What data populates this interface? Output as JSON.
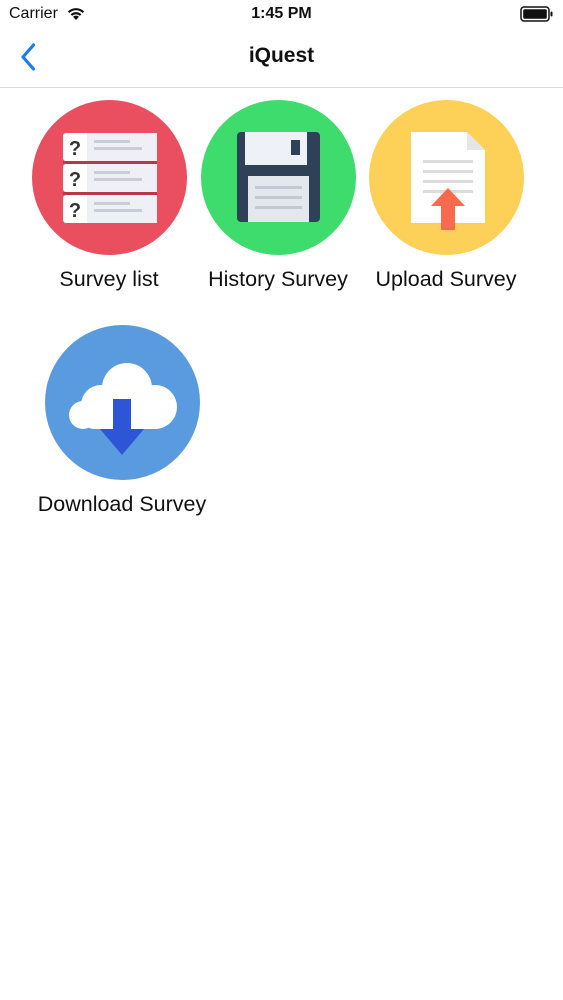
{
  "status_bar": {
    "carrier": "Carrier",
    "time": "1:45 PM",
    "wifi_icon": "wifi-icon",
    "battery_icon": "battery-icon"
  },
  "nav": {
    "back_icon": "chevron-left-icon",
    "title": "iQuest",
    "accent_color": "#1b7cf2"
  },
  "menu": {
    "items": [
      {
        "label": "Survey list",
        "icon": "question-list-icon",
        "color": "#e94f5f"
      },
      {
        "label": "History Survey",
        "icon": "floppy-disk-icon",
        "color": "#3ddc6c"
      },
      {
        "label": "Upload Survey",
        "icon": "document-upload-icon",
        "color": "#fdd058"
      },
      {
        "label": "Download Survey",
        "icon": "cloud-download-icon",
        "color": "#5a9be0"
      }
    ]
  }
}
